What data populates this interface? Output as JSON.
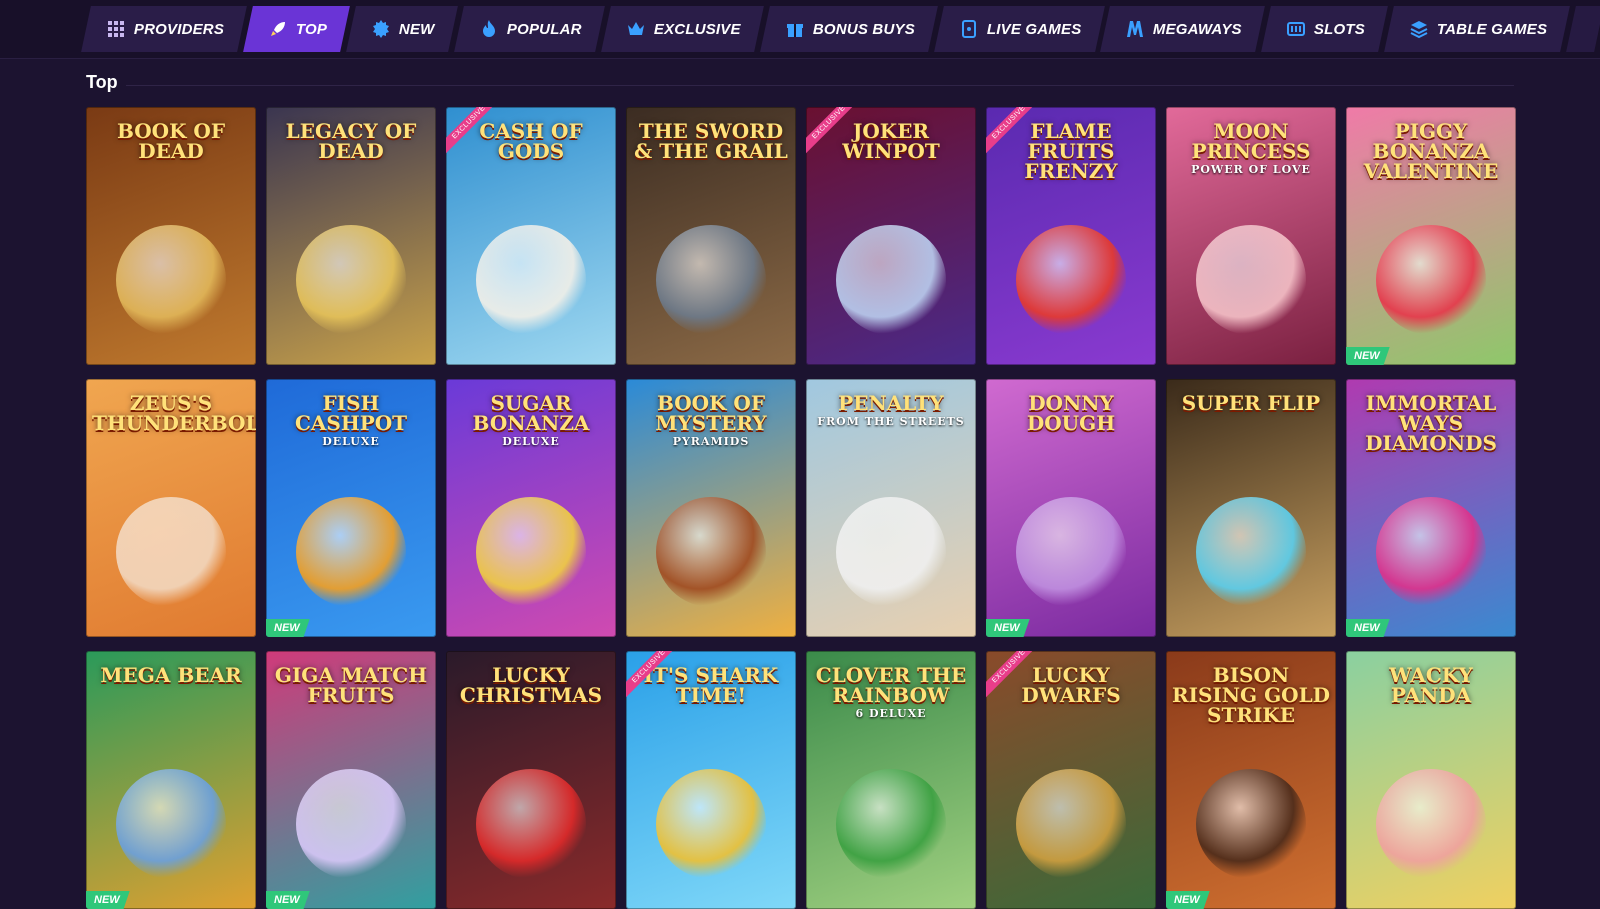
{
  "nav": {
    "tabs": [
      {
        "label": "PROVIDERS",
        "icon": "grid-icon",
        "active": false
      },
      {
        "label": "TOP",
        "icon": "rocket-icon",
        "active": true
      },
      {
        "label": "NEW",
        "icon": "new-badge-icon",
        "active": false
      },
      {
        "label": "POPULAR",
        "icon": "flame-icon",
        "active": false
      },
      {
        "label": "EXCLUSIVE",
        "icon": "crown-icon",
        "active": false
      },
      {
        "label": "BONUS BUYS",
        "icon": "gift-icon",
        "active": false
      },
      {
        "label": "LIVE GAMES",
        "icon": "live-card-icon",
        "active": false
      },
      {
        "label": "MEGAWAYS",
        "icon": "megaways-icon",
        "active": false
      },
      {
        "label": "SLOTS",
        "icon": "slot-machine-icon",
        "active": false
      },
      {
        "label": "TABLE GAMES",
        "icon": "layers-icon",
        "active": false
      }
    ]
  },
  "section": {
    "title": "Top"
  },
  "new_label": "NEW",
  "exclusive_label": "EXCLUSIVE",
  "games": [
    {
      "title": "Book of Dead",
      "sub": "",
      "bg": [
        "#7a3a14",
        "#c07a2e"
      ],
      "art": "#e2b85a",
      "new": false,
      "exclusive": false
    },
    {
      "title": "Legacy of Dead",
      "sub": "",
      "bg": [
        "#3a3550",
        "#c9a24a"
      ],
      "art": "#e6c35a",
      "new": false,
      "exclusive": false
    },
    {
      "title": "Cash of Gods",
      "sub": "",
      "bg": [
        "#2f8fd0",
        "#9fd8f0"
      ],
      "art": "#f3f0e8",
      "new": false,
      "exclusive": true
    },
    {
      "title": "The Sword & the Grail",
      "sub": "",
      "bg": [
        "#3b2c22",
        "#8c6a46"
      ],
      "art": "#6d7b8c",
      "new": false,
      "exclusive": false
    },
    {
      "title": "Joker Winpot",
      "sub": "",
      "bg": [
        "#6a1030",
        "#4a2a8a"
      ],
      "art": "#bcd0f0",
      "new": false,
      "exclusive": true
    },
    {
      "title": "Flame Fruits Frenzy",
      "sub": "",
      "bg": [
        "#5a2ab0",
        "#8a3ad0"
      ],
      "art": "#e83a2a",
      "new": false,
      "exclusive": true
    },
    {
      "title": "Moon Princess",
      "sub": "Power of Love",
      "bg": [
        "#e26a9a",
        "#7a2040"
      ],
      "art": "#f5c2c8",
      "new": false,
      "exclusive": false
    },
    {
      "title": "Piggy Bonanza Valentine",
      "sub": "",
      "bg": [
        "#f07aa8",
        "#8ec86a"
      ],
      "art": "#e8344a",
      "new": true,
      "exclusive": false
    },
    {
      "title": "Zeus's Thunderbolt",
      "sub": "",
      "bg": [
        "#f0a650",
        "#e07a30"
      ],
      "art": "#f2d8c0",
      "new": false,
      "exclusive": false
    },
    {
      "title": "Fish Cashpot",
      "sub": "Deluxe",
      "bg": [
        "#1f6ad8",
        "#3a9af0"
      ],
      "art": "#f5a020",
      "new": true,
      "exclusive": false
    },
    {
      "title": "Sugar Bonanza",
      "sub": "Deluxe",
      "bg": [
        "#6a3ad8",
        "#d04ab0"
      ],
      "art": "#f0d040",
      "new": false,
      "exclusive": false
    },
    {
      "title": "Book of Mystery",
      "sub": "Pyramids",
      "bg": [
        "#2a8ad8",
        "#f0b040"
      ],
      "art": "#a04a20",
      "new": false,
      "exclusive": false
    },
    {
      "title": "Penalty",
      "sub": "From the Streets",
      "bg": [
        "#a0c8e0",
        "#e8d0b0"
      ],
      "art": "#f0f0f0",
      "new": false,
      "exclusive": false
    },
    {
      "title": "Donny Dough",
      "sub": "",
      "bg": [
        "#d06ad0",
        "#7a2aa0"
      ],
      "art": "#c090e0",
      "new": true,
      "exclusive": false
    },
    {
      "title": "Super Flip",
      "sub": "",
      "bg": [
        "#3a2a1a",
        "#c8a060"
      ],
      "art": "#5ad0f0",
      "new": false,
      "exclusive": false
    },
    {
      "title": "Immortal Ways Diamonds",
      "sub": "",
      "bg": [
        "#b03ab0",
        "#3a8ad0"
      ],
      "art": "#e0308a",
      "new": true,
      "exclusive": false
    },
    {
      "title": "Mega Bear",
      "sub": "",
      "bg": [
        "#2a9a5a",
        "#e0a030"
      ],
      "art": "#6aa0e0",
      "new": true,
      "exclusive": false
    },
    {
      "title": "Giga Match Fruits",
      "sub": "",
      "bg": [
        "#d03a7a",
        "#30a0a0"
      ],
      "art": "#d8c8f8",
      "new": true,
      "exclusive": false
    },
    {
      "title": "Lucky Christmas",
      "sub": "",
      "bg": [
        "#2a1a2a",
        "#8a2a2a"
      ],
      "art": "#e02a2a",
      "new": false,
      "exclusive": false
    },
    {
      "title": "It's Shark Time!",
      "sub": "",
      "bg": [
        "#2aa0e8",
        "#80d8f8"
      ],
      "art": "#f0c030",
      "new": false,
      "exclusive": true
    },
    {
      "title": "Clover the Rainbow",
      "sub": "6 Deluxe",
      "bg": [
        "#3a8a4a",
        "#a0d080"
      ],
      "art": "#3aa040",
      "new": false,
      "exclusive": false
    },
    {
      "title": "Lucky Dwarfs",
      "sub": "",
      "bg": [
        "#8a4a2a",
        "#3a6a3a"
      ],
      "art": "#d0a040",
      "new": false,
      "exclusive": true
    },
    {
      "title": "Bison Rising Gold Strike",
      "sub": "",
      "bg": [
        "#8a3a1a",
        "#d07030"
      ],
      "art": "#4a2a1a",
      "new": true,
      "exclusive": false
    },
    {
      "title": "Wacky Panda",
      "sub": "",
      "bg": [
        "#8ad0a0",
        "#f0d060"
      ],
      "art": "#f0a0a0",
      "new": false,
      "exclusive": false
    }
  ]
}
